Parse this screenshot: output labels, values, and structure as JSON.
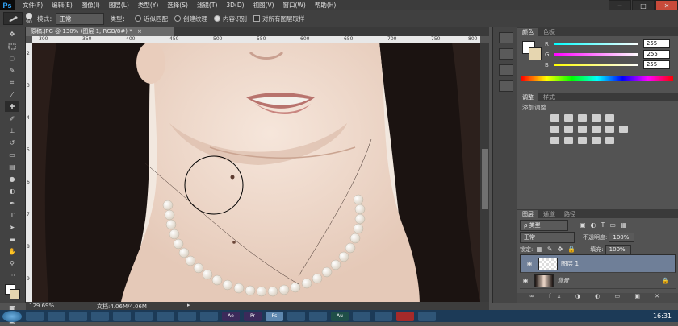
{
  "menubar": {
    "logo": "Ps",
    "items": [
      "文件(F)",
      "编辑(E)",
      "图像(I)",
      "图层(L)",
      "类型(Y)",
      "选择(S)",
      "滤镜(T)",
      "3D(D)",
      "视图(V)",
      "窗口(W)",
      "帮助(H)"
    ]
  },
  "window_controls": {
    "minimize": "─",
    "restore": "□",
    "close": "✕"
  },
  "options_bar": {
    "brush_size": "90",
    "mode_label": "模式：",
    "mode_value": "正常",
    "type_label": "类型：",
    "type_options": [
      "近似匹配",
      "创建纹理",
      "内容识别"
    ],
    "type_selected_index": 2,
    "sample_all_layers": "对所有图层取样"
  },
  "document": {
    "tab_title": "原稿.JPG @ 130% (图层 1, RGB/8#) *",
    "tab_close": "×",
    "ruler_h_ticks": [
      "300",
      "350",
      "400",
      "450",
      "500",
      "550",
      "600",
      "650",
      "700",
      "750",
      "800"
    ],
    "ruler_v_ticks": [
      "2",
      "3",
      "4",
      "5",
      "6",
      "7",
      "8",
      "9"
    ]
  },
  "statusbar": {
    "zoom": "129.69%",
    "doc_info": "文档:4.06M/4.06M"
  },
  "color_panel": {
    "tabs": [
      "颜色",
      "色板"
    ],
    "channels": [
      {
        "label": "R",
        "value": "255"
      },
      {
        "label": "G",
        "value": "255"
      },
      {
        "label": "B",
        "value": "255"
      }
    ]
  },
  "adjustments_panel": {
    "tabs": [
      "调整",
      "样式"
    ],
    "title": "添加调整"
  },
  "layers_panel": {
    "tabs": [
      "图层",
      "通道",
      "路径"
    ],
    "filter_label": "ρ 类型",
    "blend_mode": "正常",
    "opacity_label": "不透明度:",
    "opacity_value": "100%",
    "lock_label": "锁定:",
    "fill_label": "填充:",
    "fill_value": "100%",
    "layers": [
      {
        "name": "图层 1",
        "selected": true
      },
      {
        "name": "背景",
        "selected": false
      }
    ]
  },
  "taskbar": {
    "apps": [
      "",
      "",
      "",
      "",
      "",
      "",
      "",
      "",
      "",
      "Ae",
      "Pr",
      "Ps",
      "",
      "",
      "Au",
      "",
      "",
      "",
      ""
    ],
    "active_index": 11,
    "time": "16:31"
  },
  "colors": {
    "menubar_bg": "#3c3c3c",
    "panel_bg": "#535353",
    "selected_layer": "#6f7f98",
    "taskbar_bg": "#1c3a57"
  }
}
